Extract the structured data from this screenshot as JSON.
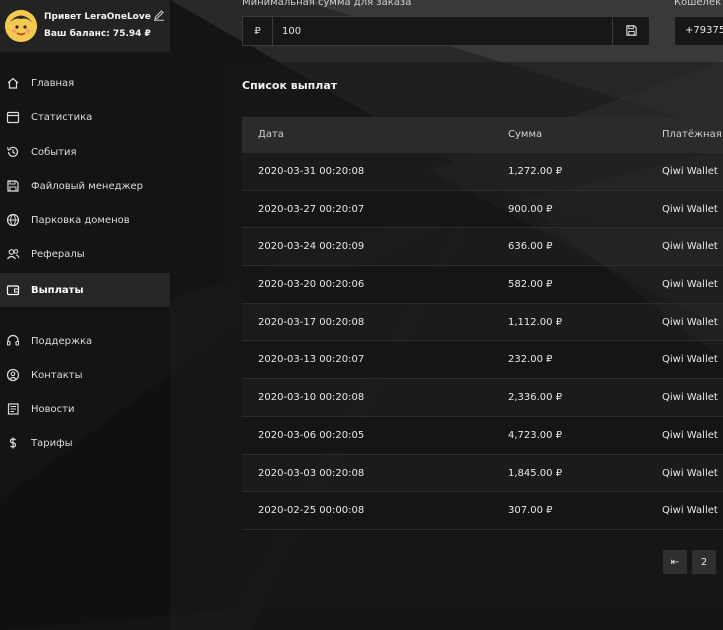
{
  "profile": {
    "greeting": "Привет LeraOneLove",
    "balance": "Ваш баланс: 75.94 ₽"
  },
  "nav": [
    {
      "label": "Главная",
      "icon": "home-icon"
    },
    {
      "label": "Статистика",
      "icon": "calendar-icon"
    },
    {
      "label": "События",
      "icon": "history-icon"
    },
    {
      "label": "Файловый менеджер",
      "icon": "save-icon"
    },
    {
      "label": "Парковка доменов",
      "icon": "globe-icon"
    },
    {
      "label": "Рефералы",
      "icon": "users-icon"
    },
    {
      "label": "Выплаты",
      "icon": "wallet-icon",
      "active": true
    },
    {
      "label": "Поддержка",
      "icon": "headset-icon"
    },
    {
      "label": "Контакты",
      "icon": "user-circle-icon"
    },
    {
      "label": "Новости",
      "icon": "newspaper-icon"
    },
    {
      "label": "Тарифы",
      "icon": "dollar-icon"
    }
  ],
  "settings": {
    "min_sum_label": "Минимальная сумма для заказа",
    "currency_symbol": "₽",
    "min_sum_value": "100",
    "wallet_label": "Кошелек",
    "wallet_value": "+79375"
  },
  "payouts": {
    "title": "Список выплат",
    "columns": [
      "Дата",
      "Сумма",
      "Платёжная с"
    ],
    "rows": [
      [
        "2020-03-31 00:20:08",
        "1,272.00 ₽",
        "Qiwi Wallet"
      ],
      [
        "2020-03-27 00:20:07",
        "900.00 ₽",
        "Qiwi Wallet"
      ],
      [
        "2020-03-24 00:20:09",
        "636.00 ₽",
        "Qiwi Wallet"
      ],
      [
        "2020-03-20 00:20:06",
        "582.00 ₽",
        "Qiwi Wallet"
      ],
      [
        "2020-03-17 00:20:08",
        "1,112.00 ₽",
        "Qiwi Wallet"
      ],
      [
        "2020-03-13 00:20:07",
        "232.00 ₽",
        "Qiwi Wallet"
      ],
      [
        "2020-03-10 00:20:08",
        "2,336.00 ₽",
        "Qiwi Wallet"
      ],
      [
        "2020-03-06 00:20:05",
        "4,723.00 ₽",
        "Qiwi Wallet"
      ],
      [
        "2020-03-03 00:20:08",
        "1,845.00 ₽",
        "Qiwi Wallet"
      ],
      [
        "2020-02-25 00:00:08",
        "307.00 ₽",
        "Qiwi Wallet"
      ]
    ]
  },
  "pagination": {
    "first_label": "⇤",
    "page_2": "2"
  },
  "colors": {
    "background": "#151515",
    "sidebar_active": "#262626",
    "avatar": "#f1c84b"
  }
}
